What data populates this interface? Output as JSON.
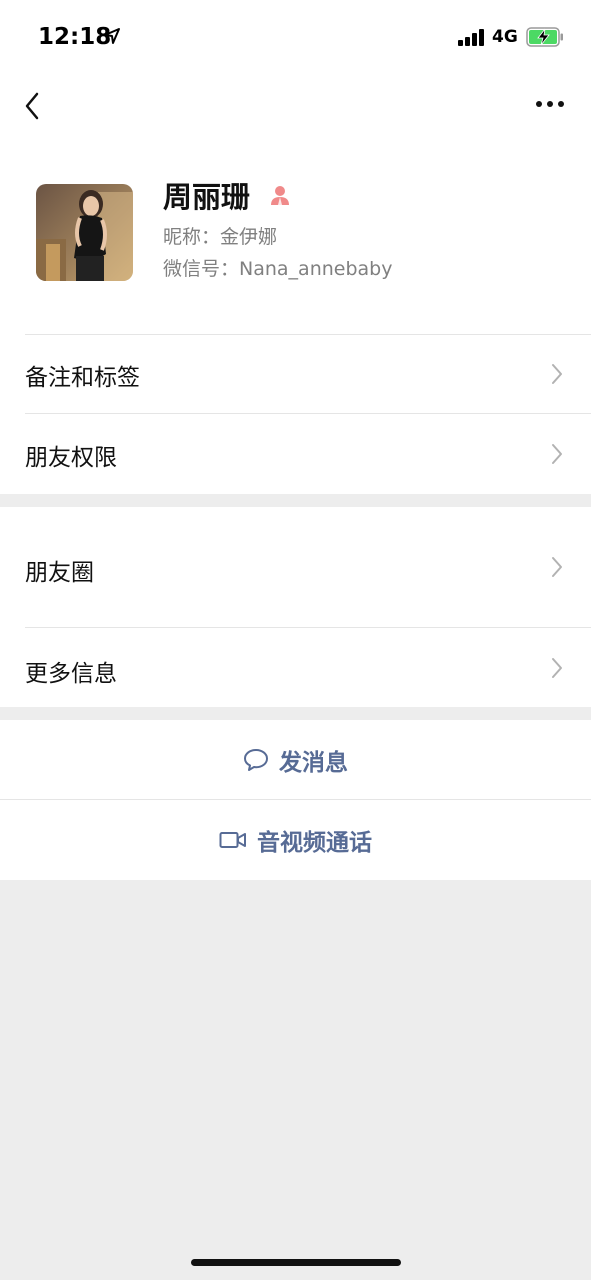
{
  "status": {
    "time": "12:18",
    "network": "4G"
  },
  "profile": {
    "name": "周丽珊",
    "nickname_label": "昵称：",
    "nickname": "金伊娜",
    "wechat_id_label": "微信号：",
    "wechat_id": "Nana_annebaby"
  },
  "menu": {
    "remark_tags": "备注和标签",
    "friend_permissions": "朋友权限",
    "moments": "朋友圈",
    "more_info": "更多信息"
  },
  "actions": {
    "send_message": "发消息",
    "video_call": "音视频通话"
  },
  "colors": {
    "link": "#576b95",
    "background": "#ededed",
    "gender_female": "#f08a8a"
  },
  "icons": [
    "location-arrow-icon",
    "signal-icon",
    "battery-charging-icon",
    "back-icon",
    "more-icon",
    "female-icon",
    "chevron-right-icon",
    "chat-bubble-icon",
    "video-camera-icon"
  ]
}
